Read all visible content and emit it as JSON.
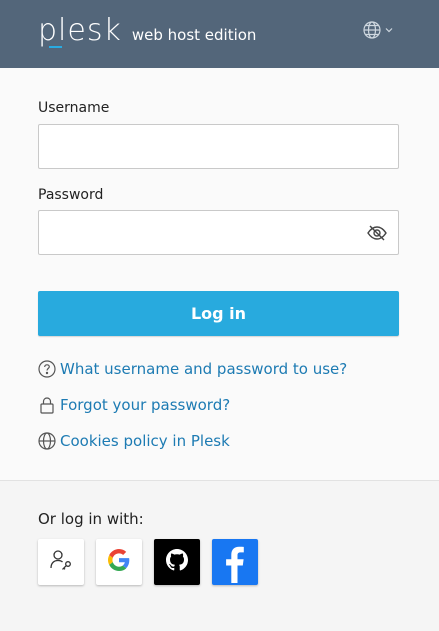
{
  "header": {
    "logo_text": "plesk",
    "edition": "web host edition",
    "language_icon": "globe-icon",
    "language_dropdown_icon": "chevron-down-icon",
    "background_color": "#53667a"
  },
  "form": {
    "username": {
      "label": "Username",
      "value": "",
      "placeholder": ""
    },
    "password": {
      "label": "Password",
      "value": "",
      "placeholder": "",
      "toggle_icon": "eye-slash-icon"
    },
    "submit_label": "Log in",
    "accent_color": "#28aade"
  },
  "links": [
    {
      "icon": "question-circle-icon",
      "label": "What username and password to use?"
    },
    {
      "icon": "lock-icon",
      "label": "Forgot your password?"
    },
    {
      "icon": "globe-icon",
      "label": "Cookies policy in Plesk"
    }
  ],
  "social": {
    "title": "Or log in with:",
    "providers": [
      {
        "name": "Digital ID",
        "icon": "user-key-icon"
      },
      {
        "name": "Google",
        "icon": "google-icon"
      },
      {
        "name": "GitHub",
        "icon": "github-icon"
      },
      {
        "name": "Facebook",
        "icon": "facebook-icon"
      }
    ]
  },
  "colors": {
    "link": "#1d7bb3",
    "github_bg": "#000000",
    "facebook_bg": "#1877f2"
  }
}
